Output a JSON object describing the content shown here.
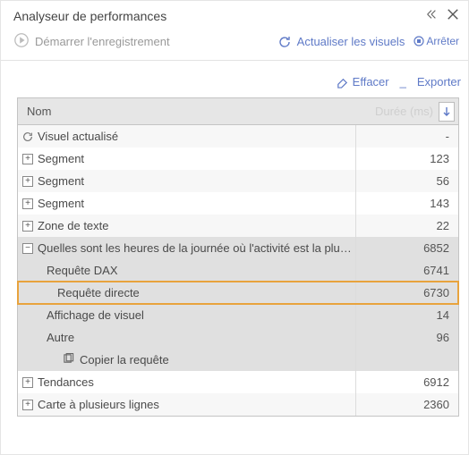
{
  "pane": {
    "title": "Analyseur de performances"
  },
  "toolbar": {
    "start_label": "Démarrer l'enregistrement",
    "refresh_label": "Actualiser les visuels",
    "stop_label": "Arrêter",
    "clear_label": "Effacer",
    "export_label": "Exporter"
  },
  "grid": {
    "header_name": "Nom",
    "header_duration": "Durée (ms)"
  },
  "rows": {
    "r0": {
      "label": "Visuel actualisé",
      "value": "-"
    },
    "r1": {
      "label": "Segment",
      "value": "123"
    },
    "r2": {
      "label": "Segment",
      "value": "56"
    },
    "r3": {
      "label": "Segment",
      "value": "143"
    },
    "r4": {
      "label": "Zone de texte",
      "value": "22"
    },
    "r5": {
      "label": "Quelles sont les heures de la journée où l'activité est la plus forte ?",
      "value": "6852"
    },
    "r6": {
      "label": "Requête DAX",
      "value": "6741"
    },
    "r7": {
      "label": "Requête directe",
      "value": "6730"
    },
    "r8": {
      "label": "Affichage de visuel",
      "value": "14"
    },
    "r9": {
      "label": "Autre",
      "value": "96"
    },
    "r10": {
      "label": "Copier la requête"
    },
    "r11": {
      "label": "Tendances",
      "value": "6912"
    },
    "r12": {
      "label": "Carte à plusieurs lignes",
      "value": "2360"
    }
  }
}
